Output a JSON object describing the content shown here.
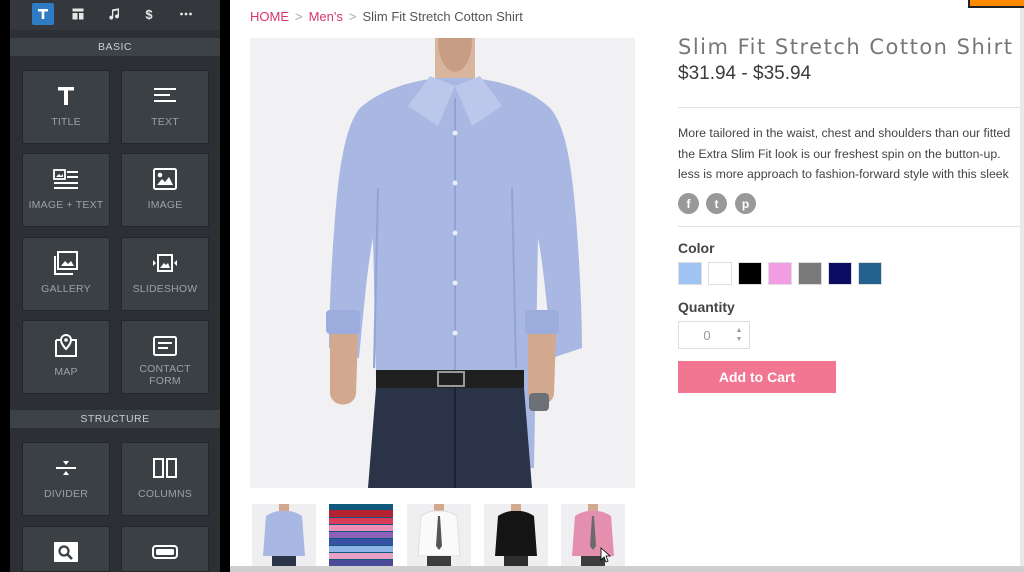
{
  "toolbar": {
    "icons": [
      "text-icon",
      "layout-icon",
      "music-icon",
      "dollar-icon",
      "more-icon"
    ]
  },
  "sections": {
    "basic": "BASIC",
    "structure": "STRUCTURE"
  },
  "elements": {
    "title": "TITLE",
    "text": "TEXT",
    "image_text": "IMAGE + TEXT",
    "image": "IMAGE",
    "gallery": "GALLERY",
    "slideshow": "SLIDESHOW",
    "map": "MAP",
    "contact_form": "CONTACT FORM",
    "divider": "DIVIDER",
    "columns": "COLUMNS"
  },
  "breadcrumb": {
    "home": "HOME",
    "category": "Men's",
    "current": "Slim Fit Stretch Cotton Shirt",
    "separator": ">"
  },
  "product": {
    "title": "Slim Fit Stretch Cotton Shirt",
    "price": "$31.94 - $35.94",
    "description_lines": [
      "More tailored in the waist, chest and shoulders than our fitted",
      "the Extra Slim Fit look is our freshest spin on the button-up.",
      "less is more approach to fashion-forward style with this sleek"
    ],
    "color_label": "Color",
    "colors": [
      "#9fc3f2",
      "#ffffff",
      "#000000",
      "#f29ce4",
      "#7a7a7a",
      "#0c0c62",
      "#23628f"
    ],
    "quantity_label": "Quantity",
    "quantity_value": "0",
    "add_to_cart": "Add to Cart",
    "social": {
      "facebook": "f",
      "twitter": "t",
      "pinterest": "p"
    },
    "thumbnails": [
      "light-blue-shirt",
      "folded-shirts-stack",
      "white-shirt",
      "black-shirt",
      "pink-shirt"
    ]
  },
  "colors": {
    "accent_pink": "#f27692",
    "breadcrumb_link": "#d9366a",
    "sidebar_bg": "#2c2f33",
    "active_tool": "#2f7cc4"
  }
}
